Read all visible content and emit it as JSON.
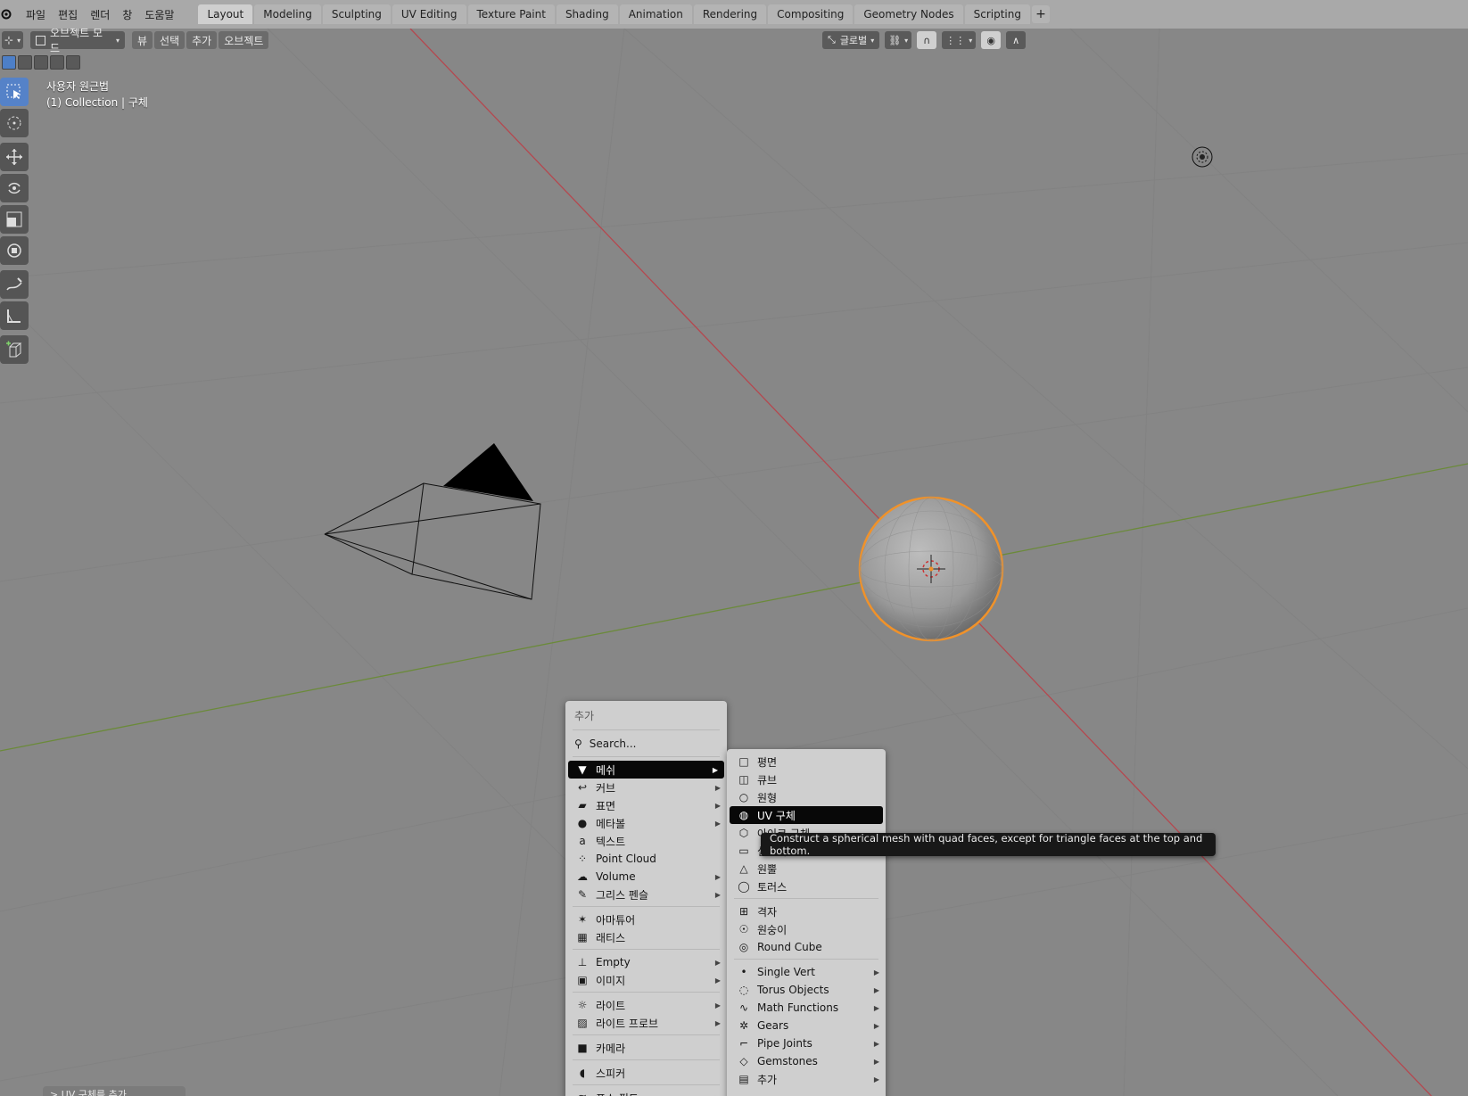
{
  "topbar": {
    "menus": [
      "파일",
      "편집",
      "렌더",
      "창",
      "도움말"
    ],
    "workspaces": [
      "Layout",
      "Modeling",
      "Sculpting",
      "UV Editing",
      "Texture Paint",
      "Shading",
      "Animation",
      "Rendering",
      "Compositing",
      "Geometry Nodes",
      "Scripting"
    ],
    "active_workspace": "Layout",
    "add_workspace": "+"
  },
  "viewport_header": {
    "mode": "오브젝트 모드",
    "menus": [
      "뷰",
      "선택",
      "추가",
      "오브젝트"
    ],
    "orientation": "글로벌"
  },
  "viewport_info": {
    "view_name": "사용자 원근법",
    "collection": "(1) Collection | 구체"
  },
  "add_menu": {
    "title": "추가",
    "search": "Search...",
    "items": [
      {
        "label": "메쉬",
        "icon": "mesh-icon",
        "submenu": true,
        "selected": true
      },
      {
        "label": "커브",
        "icon": "curve-icon",
        "submenu": true
      },
      {
        "label": "표면",
        "icon": "surface-icon",
        "submenu": true
      },
      {
        "label": "메타볼",
        "icon": "metaball-icon",
        "submenu": true
      },
      {
        "label": "텍스트",
        "icon": "text-icon",
        "submenu": false
      },
      {
        "label": "Point Cloud",
        "icon": "point-cloud-icon",
        "submenu": false
      },
      {
        "label": "Volume",
        "icon": "volume-icon",
        "submenu": true
      },
      {
        "label": "그리스 펜슬",
        "icon": "grease-pencil-icon",
        "submenu": true
      },
      {
        "label": "아마튜어",
        "icon": "armature-icon",
        "submenu": false,
        "sep_before": true
      },
      {
        "label": "래티스",
        "icon": "lattice-icon",
        "submenu": false
      },
      {
        "label": "Empty",
        "icon": "empty-icon",
        "submenu": true,
        "sep_before": true
      },
      {
        "label": "이미지",
        "icon": "image-icon",
        "submenu": true
      },
      {
        "label": "라이트",
        "icon": "light-icon",
        "submenu": true,
        "sep_before": true
      },
      {
        "label": "라이트 프로브",
        "icon": "light-probe-icon",
        "submenu": true
      },
      {
        "label": "카메라",
        "icon": "camera-icon",
        "submenu": false,
        "sep_before": true
      },
      {
        "label": "스피커",
        "icon": "speaker-icon",
        "submenu": false,
        "sep_before": true
      },
      {
        "label": "포스 필드",
        "icon": "force-field-icon",
        "submenu": true,
        "sep_before": true
      }
    ]
  },
  "mesh_menu": {
    "items": [
      {
        "label": "평면",
        "icon": "plane-icon",
        "submenu": false
      },
      {
        "label": "큐브",
        "icon": "cube-icon",
        "submenu": false
      },
      {
        "label": "원형",
        "icon": "circle-icon",
        "submenu": false
      },
      {
        "label": "UV 구체",
        "icon": "uv-sphere-icon",
        "submenu": false,
        "selected": true
      },
      {
        "label": "아이코 구체",
        "icon": "ico-sphere-icon",
        "submenu": false
      },
      {
        "label": "실린더",
        "icon": "cylinder-icon",
        "submenu": false
      },
      {
        "label": "원뿔",
        "icon": "cone-icon",
        "submenu": false
      },
      {
        "label": "토러스",
        "icon": "torus-icon",
        "submenu": false
      },
      {
        "label": "격자",
        "icon": "grid-icon",
        "submenu": false,
        "sep_before": true
      },
      {
        "label": "원숭이",
        "icon": "monkey-icon",
        "submenu": false
      },
      {
        "label": "Round Cube",
        "icon": "round-cube-icon",
        "submenu": false
      },
      {
        "label": "Single Vert",
        "icon": "single-vert-icon",
        "submenu": true,
        "sep_before": true
      },
      {
        "label": "Torus Objects",
        "icon": "torus-objects-icon",
        "submenu": true
      },
      {
        "label": "Math Functions",
        "icon": "math-functions-icon",
        "submenu": true
      },
      {
        "label": "Gears",
        "icon": "gears-icon",
        "submenu": true
      },
      {
        "label": "Pipe Joints",
        "icon": "pipe-joints-icon",
        "submenu": true
      },
      {
        "label": "Gemstones",
        "icon": "gemstones-icon",
        "submenu": true
      },
      {
        "label": "추가",
        "icon": "add-more-icon",
        "submenu": true
      }
    ]
  },
  "tooltip": "Construct a spherical mesh with quad faces, except for triangle faces at the top and bottom.",
  "last_operator": "> UV 구체를 추가",
  "colors": {
    "topbar": "#a9a9a9",
    "viewport": "#878787",
    "accent": "#5582c8",
    "selection_outline": "#f0922a",
    "x_axis": "#b5484f",
    "y_axis": "#6b8a3a"
  }
}
